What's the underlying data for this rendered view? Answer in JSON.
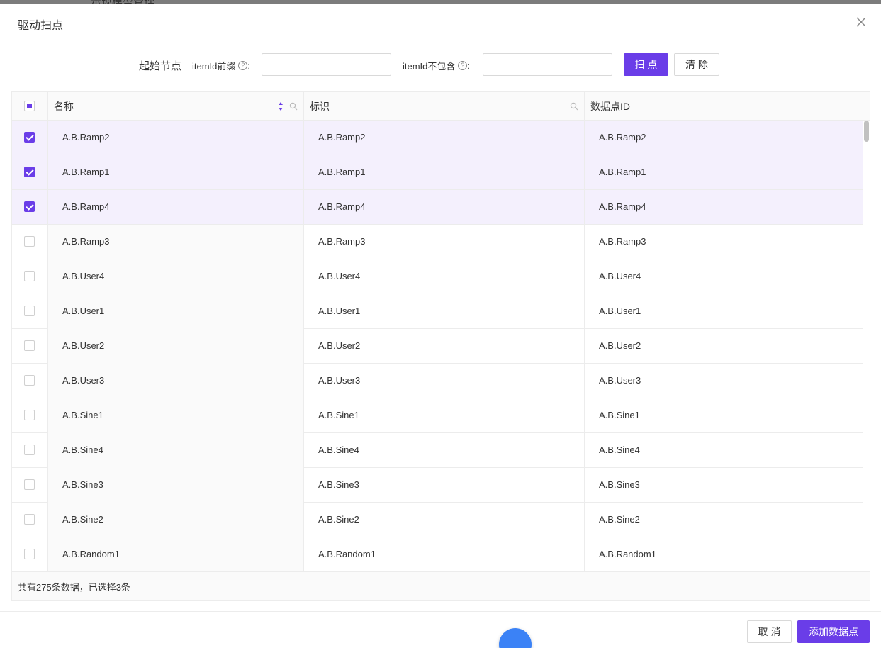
{
  "background": {
    "hint_text": "示现模型管理"
  },
  "dialog": {
    "title": "驱动扫点",
    "close_icon": "close-icon"
  },
  "filter": {
    "start_node_label": "起始节点",
    "prefix_label": "itemId前缀",
    "prefix_value": "",
    "exclude_label": "itemId不包含",
    "exclude_value": "",
    "colon": ":",
    "scan_button": "扫 点",
    "clear_button": "清 除"
  },
  "table": {
    "columns": {
      "name": "名称",
      "key": "标识",
      "id": "数据点ID"
    },
    "rows": [
      {
        "name": "A.B.Ramp2",
        "key": "A.B.Ramp2",
        "id": "A.B.Ramp2",
        "checked": true
      },
      {
        "name": "A.B.Ramp1",
        "key": "A.B.Ramp1",
        "id": "A.B.Ramp1",
        "checked": true
      },
      {
        "name": "A.B.Ramp4",
        "key": "A.B.Ramp4",
        "id": "A.B.Ramp4",
        "checked": true
      },
      {
        "name": "A.B.Ramp3",
        "key": "A.B.Ramp3",
        "id": "A.B.Ramp3",
        "checked": false
      },
      {
        "name": "A.B.User4",
        "key": "A.B.User4",
        "id": "A.B.User4",
        "checked": false
      },
      {
        "name": "A.B.User1",
        "key": "A.B.User1",
        "id": "A.B.User1",
        "checked": false
      },
      {
        "name": "A.B.User2",
        "key": "A.B.User2",
        "id": "A.B.User2",
        "checked": false
      },
      {
        "name": "A.B.User3",
        "key": "A.B.User3",
        "id": "A.B.User3",
        "checked": false
      },
      {
        "name": "A.B.Sine1",
        "key": "A.B.Sine1",
        "id": "A.B.Sine1",
        "checked": false
      },
      {
        "name": "A.B.Sine4",
        "key": "A.B.Sine4",
        "id": "A.B.Sine4",
        "checked": false
      },
      {
        "name": "A.B.Sine3",
        "key": "A.B.Sine3",
        "id": "A.B.Sine3",
        "checked": false
      },
      {
        "name": "A.B.Sine2",
        "key": "A.B.Sine2",
        "id": "A.B.Sine2",
        "checked": false
      },
      {
        "name": "A.B.Random1",
        "key": "A.B.Random1",
        "id": "A.B.Random1",
        "checked": false
      }
    ],
    "summary": "共有275条数据，已选择3条"
  },
  "footer": {
    "cancel_button": "取 消",
    "add_button": "添加数据点"
  },
  "colors": {
    "primary": "#6a3de8",
    "selected_row": "#f4f0fd",
    "fab": "#3b82f6"
  }
}
